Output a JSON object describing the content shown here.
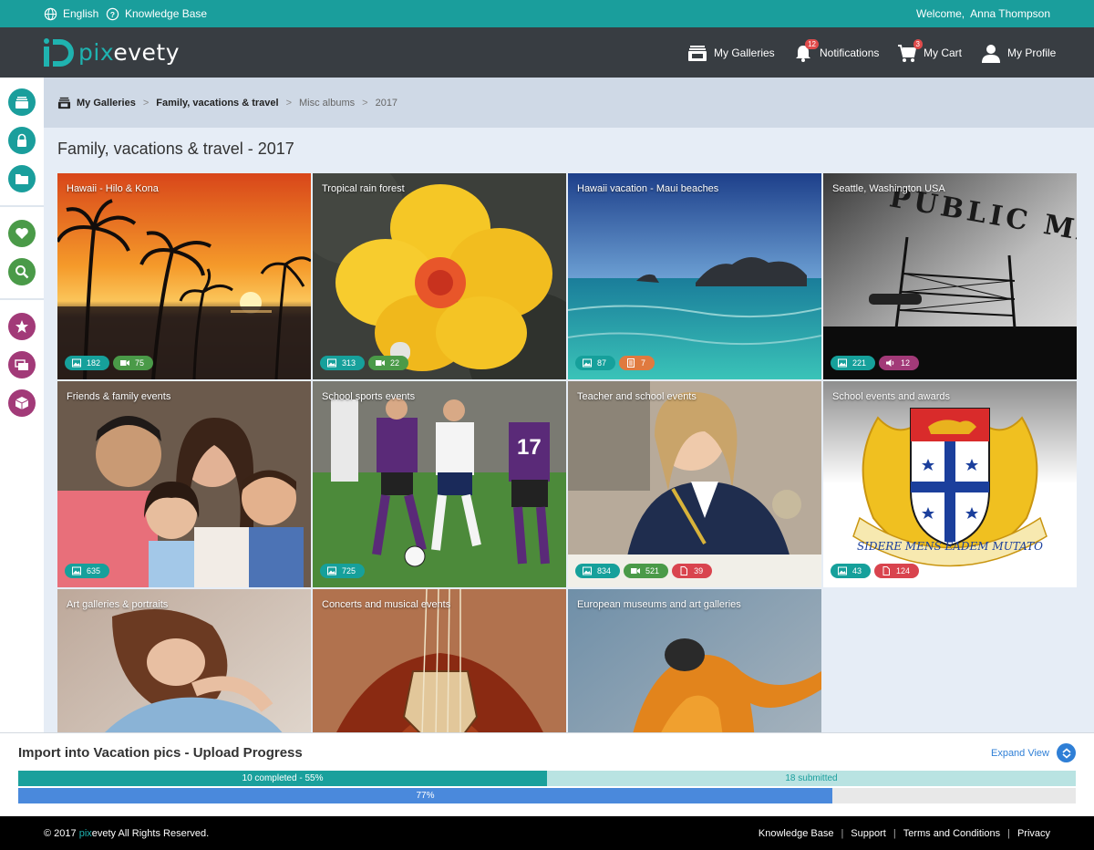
{
  "topbar": {
    "language": "English",
    "knowledge_base": "Knowledge Base",
    "welcome": "Welcome,  Anna Thompson"
  },
  "header": {
    "logo_pix": "pix",
    "logo_rest": "evety",
    "nav": {
      "galleries": "My Galleries",
      "notifications": "Notifications",
      "notifications_count": "12",
      "cart": "My Cart",
      "cart_count": "3",
      "profile": "My Profile"
    }
  },
  "breadcrumb": {
    "root": "My Galleries",
    "level1": "Family, vacations & travel",
    "level2": "Misc albums",
    "level3": "2017",
    "separator": ">"
  },
  "page_title": "Family, vacations & travel - 2017",
  "albums": [
    {
      "title": "Hawaii - Hilo & Kona",
      "photos": "182",
      "videos": "75"
    },
    {
      "title": "Tropical rain forest",
      "photos": "313",
      "videos": "22"
    },
    {
      "title": "Hawaii vacation - Maui beaches",
      "photos": "87",
      "docs": "7"
    },
    {
      "title": "Seattle, Washington USA",
      "photos": "221",
      "audio": "12"
    },
    {
      "title": "Friends & family events",
      "photos": "635"
    },
    {
      "title": "School sports events",
      "photos": "725"
    },
    {
      "title": "Teacher and school events",
      "photos": "834",
      "videos": "521",
      "files": "39"
    },
    {
      "title": "School events and awards",
      "photos": "43",
      "files": "124"
    },
    {
      "title": "Art galleries & portraits"
    },
    {
      "title": "Concerts and musical events"
    },
    {
      "title": "European museums and art galleries"
    }
  ],
  "art_text": {
    "public_market": "PUBLIC MARKET",
    "motto": "SIDERE MENS EADEM MUTATO"
  },
  "upload": {
    "title": "Import into Vacation pics - Upload Progress",
    "expand": "Expand View",
    "completed_label": "10 completed - 55%",
    "submitted_label": "18 submitted",
    "completed_fraction": 0.5,
    "overall_label": "77%",
    "overall_percent": 77
  },
  "footer": {
    "copy_prefix": "© 2017 ",
    "copy_pix": "pix",
    "copy_rest": "evety All Rights Reserved.",
    "links": [
      "Knowledge Base",
      "Support",
      "Terms and Conditions",
      "Privacy"
    ],
    "separator": "|"
  },
  "colors": {
    "teal": "#1a9e9c",
    "header": "#383d42",
    "blue": "#4a89dc",
    "red_badge": "#e04b4b"
  },
  "icons": {
    "sidebar": [
      "galleries-icon",
      "lock-icon",
      "folder-icon",
      "heart-icon",
      "search-icon",
      "star-icon",
      "cards-icon",
      "box-icon"
    ]
  }
}
